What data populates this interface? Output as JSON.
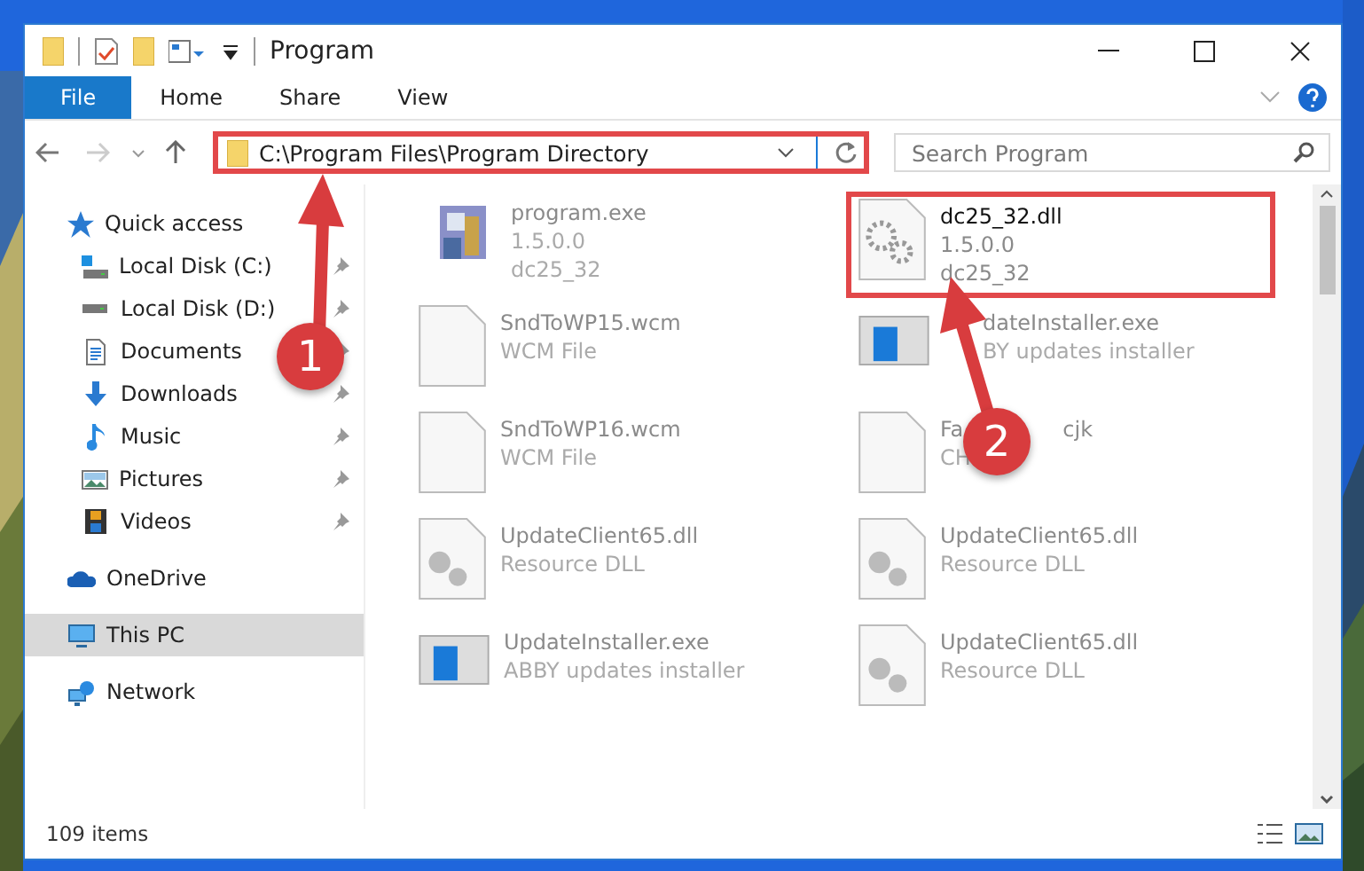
{
  "window": {
    "title": "Program"
  },
  "ribbon": {
    "tabs": [
      {
        "label": "File",
        "kind": "file",
        "selected": false
      },
      {
        "label": "Home",
        "kind": "tab",
        "selected": false
      },
      {
        "label": "Share",
        "kind": "tab",
        "selected": false
      },
      {
        "label": "View",
        "kind": "tab",
        "selected": false
      }
    ]
  },
  "address": {
    "path": "C:\\Program Files\\Program Directory"
  },
  "search": {
    "placeholder": "Search Program"
  },
  "sidebar": {
    "items": [
      {
        "label": "Quick access",
        "selected": false,
        "children": [
          {
            "label": "Local Disk (C:)",
            "pinned": true
          },
          {
            "label": "Local Disk (D:)",
            "pinned": true
          },
          {
            "label": "Documents",
            "pinned": true
          },
          {
            "label": "Downloads",
            "pinned": true
          },
          {
            "label": "Music",
            "pinned": true
          },
          {
            "label": "Pictures",
            "pinned": true
          },
          {
            "label": "Videos",
            "pinned": true
          }
        ]
      },
      {
        "label": "OneDrive",
        "selected": false
      },
      {
        "label": "This PC",
        "selected": true
      },
      {
        "label": "Network",
        "selected": false
      }
    ]
  },
  "files": [
    {
      "kind": "app",
      "name": "program.exe",
      "lines": [
        "1.5.0.0",
        "dc25_32"
      ],
      "highlighted": false
    },
    {
      "kind": "gears",
      "name": "dc25_32.dll",
      "lines": [
        "1.5.0.0",
        "dc25_32"
      ],
      "highlighted": true
    },
    {
      "kind": "doc",
      "name": "SndToWP15.wcm",
      "lines": [
        "WCM File"
      ],
      "highlighted": false
    },
    {
      "kind": "installer",
      "name": "dateInstaller.exe",
      "lines": [
        "BY updates installer"
      ],
      "highlighted": false,
      "partly_hidden": true
    },
    {
      "kind": "doc",
      "name": "SndToWP16.wcm",
      "lines": [
        "WCM File"
      ],
      "highlighted": false
    },
    {
      "kind": "doc",
      "name": "Fa",
      "name_tail": "cjk",
      "lines": [
        "CH"
      ],
      "highlighted": false
    },
    {
      "kind": "dll",
      "name": "UpdateClient65.dll",
      "lines": [
        "Resource DLL"
      ],
      "highlighted": false
    },
    {
      "kind": "dll",
      "name": "UpdateClient65.dll",
      "lines": [
        "Resource DLL"
      ],
      "highlighted": false
    },
    {
      "kind": "installer",
      "name": "UpdateInstaller.exe",
      "lines": [
        "ABBY updates installer"
      ],
      "highlighted": false
    },
    {
      "kind": "dll",
      "name": "UpdateClient65.dll",
      "lines": [
        "Resource DLL"
      ],
      "highlighted": false
    }
  ],
  "status_bar": {
    "count": "109 items"
  },
  "callouts": [
    {
      "number": "1"
    },
    {
      "number": "2"
    }
  ]
}
